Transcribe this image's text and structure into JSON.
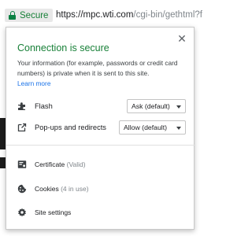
{
  "addressbar": {
    "secure_label": "Secure",
    "url_host": "https://mpc.wti.com",
    "url_path": "/cgi-bin/gethtml?f"
  },
  "popup": {
    "title": "Connection is secure",
    "description": "Your information (for example, passwords or credit card numbers) is private when it is sent to this site.",
    "learn_more": "Learn more",
    "permissions": [
      {
        "label": "Flash",
        "value": "Ask (default)",
        "icon": "puzzle-icon"
      },
      {
        "label": "Pop-ups and redirects",
        "value": "Allow (default)",
        "icon": "external-window-icon"
      }
    ],
    "links": [
      {
        "label": "Certificate",
        "detail": "(Valid)",
        "icon": "certificate-icon"
      },
      {
        "label": "Cookies",
        "detail": "(4 in use)",
        "icon": "cookie-icon"
      },
      {
        "label": "Site settings",
        "detail": "",
        "icon": "gear-icon"
      }
    ]
  },
  "colors": {
    "secure_green": "#188038",
    "link_blue": "#1a73e8"
  }
}
